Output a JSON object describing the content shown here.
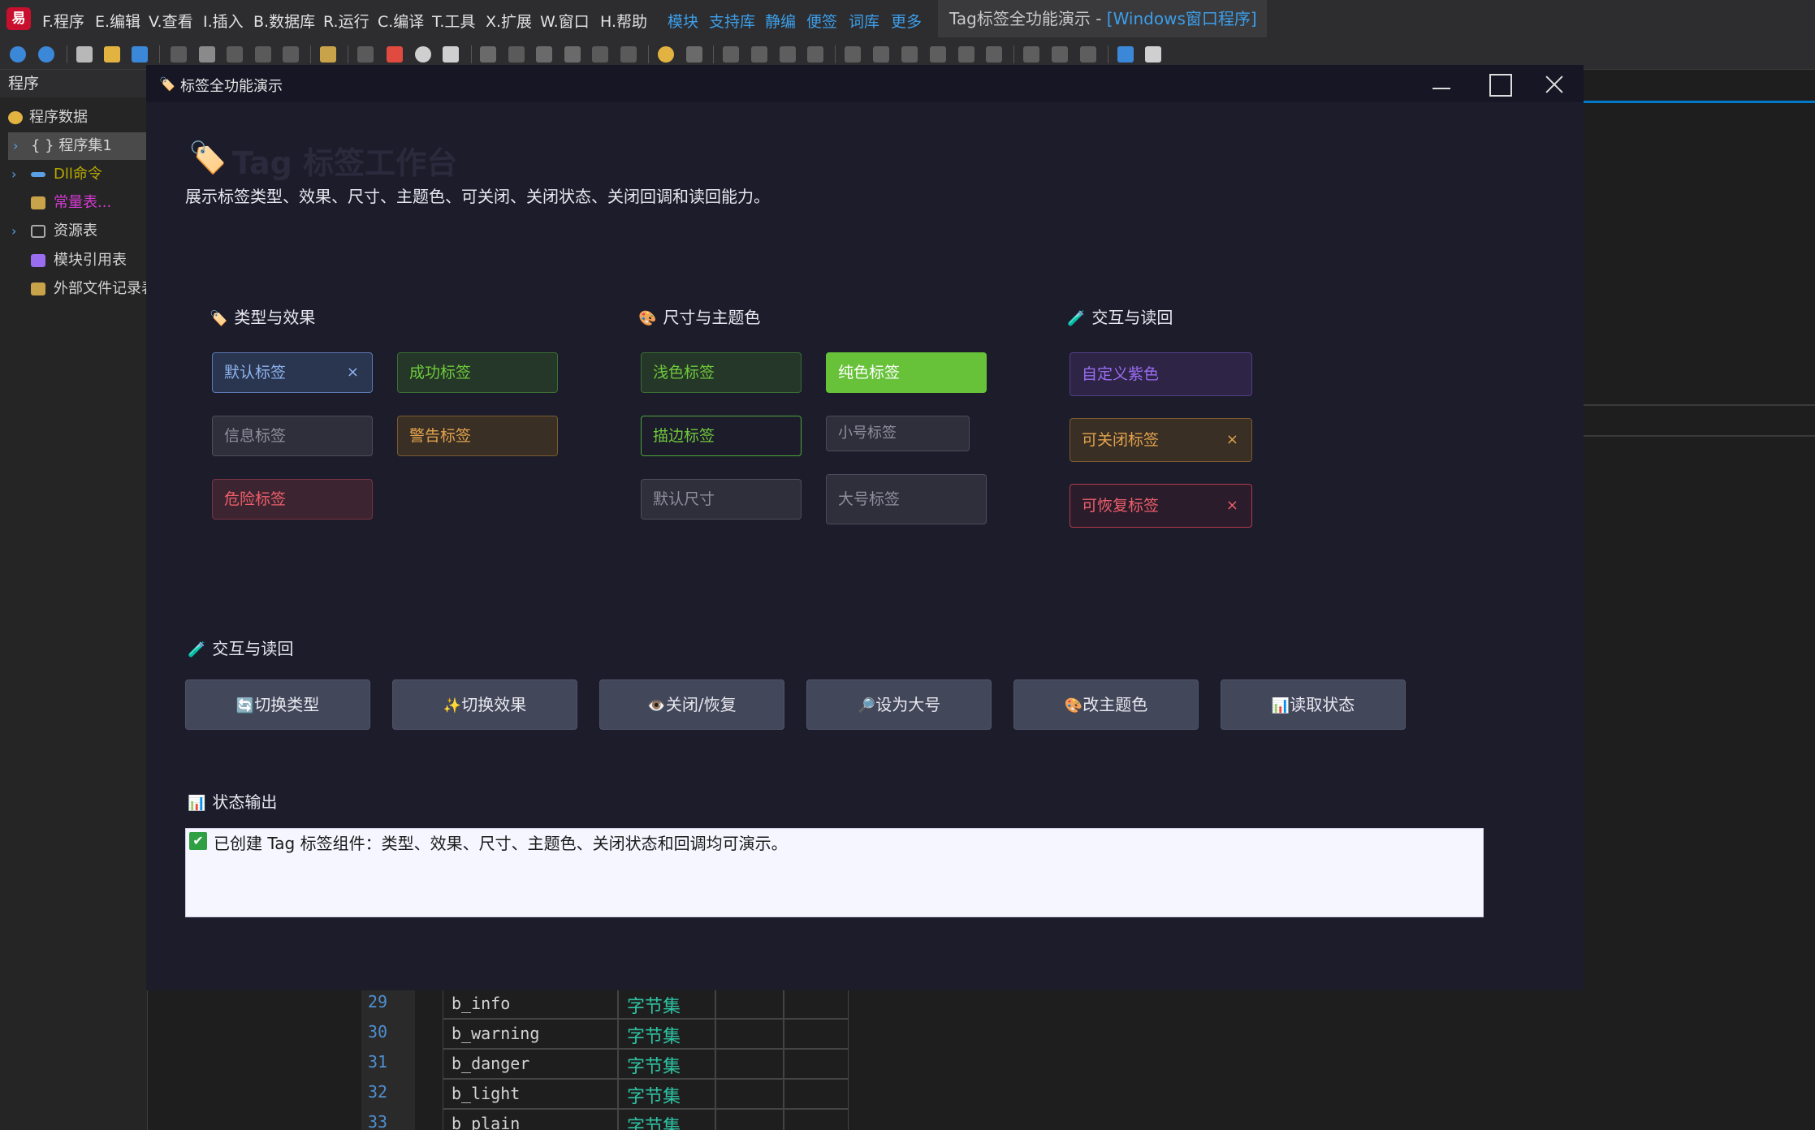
{
  "ide": {
    "logo": "易",
    "menus": [
      "F.程序",
      "E.编辑",
      "V.查看",
      "I.插入",
      "B.数据库",
      "R.运行",
      "C.编译",
      "T.工具",
      "X.扩展",
      "W.窗口",
      "H.帮助"
    ],
    "links": [
      "模块",
      "支持库",
      "静编",
      "便签",
      "词库",
      "更多"
    ],
    "title_main": "Tag标签全功能演示 - ",
    "title_suffix": "[Windows窗口程序]",
    "panel_title": "程序",
    "tree": [
      {
        "label": "程序数据",
        "color": "#d4d4d4",
        "icon": "smile-icon"
      },
      {
        "label": "{ } 程序集1",
        "color": "#d4d4d4",
        "icon": "braces-icon"
      },
      {
        "label": "Dll命令",
        "color": "#b5a800",
        "icon": "plug-icon"
      },
      {
        "label": "常量表...",
        "color": "#d63ad1",
        "icon": "table-icon"
      },
      {
        "label": "资源表",
        "color": "#d4d4d4",
        "icon": "resource-icon"
      },
      {
        "label": "模块引用表",
        "color": "#d4d4d4",
        "icon": "module-icon"
      },
      {
        "label": "外部文件记录表",
        "color": "#d4d4d4",
        "icon": "file-icon"
      }
    ],
    "code_rows": [
      {
        "ln": "29",
        "name": "b_info",
        "type": "字节集"
      },
      {
        "ln": "30",
        "name": "b_warning",
        "type": "字节集"
      },
      {
        "ln": "31",
        "name": "b_danger",
        "type": "字节集"
      },
      {
        "ln": "32",
        "name": "b_light",
        "type": "字节集"
      },
      {
        "ln": "33",
        "name": "b_plain",
        "type": "字节集"
      }
    ]
  },
  "dialog": {
    "title": "标签全功能演示",
    "hero_icon": "🏷️",
    "hero_title": "Tag 标签工作台",
    "subtitle": "展示标签类型、效果、尺寸、主题色、可关闭、关闭状态、关闭回调和读回能力。",
    "sections": {
      "types": {
        "icon": "🏷️",
        "label": "类型与效果"
      },
      "sizes": {
        "icon": "🎨",
        "label": "尺寸与主题色"
      },
      "interact": {
        "icon": "🧪",
        "label": "交互与读回"
      },
      "interact2": {
        "icon": "🧪",
        "label": "交互与读回"
      },
      "output": {
        "icon": "📊",
        "label": "状态输出"
      }
    },
    "tags": {
      "default": "默认标签",
      "success": "成功标签",
      "info": "信息标签",
      "warning": "警告标签",
      "danger": "危险标签",
      "light": "浅色标签",
      "dark": "纯色标签",
      "plain": "描边标签",
      "small": "小号标签",
      "default_size": "默认尺寸",
      "large": "大号标签",
      "purple": "自定义紫色",
      "closable": "可关闭标签",
      "restorable": "可恢复标签"
    },
    "close_glyph": "×",
    "buttons": [
      {
        "icon": "🔄",
        "label": "切换类型"
      },
      {
        "icon": "✨",
        "label": "切换效果"
      },
      {
        "icon": "👁️",
        "label": "关闭/恢复"
      },
      {
        "icon": "🔎",
        "label": "设为大号"
      },
      {
        "icon": "🎨",
        "label": "改主题色"
      },
      {
        "icon": "📊",
        "label": "读取状态"
      }
    ],
    "output_text": "已创建 Tag 标签组件：类型、效果、尺寸、主题色、关闭状态和回调均可演示。",
    "output_check": "✔"
  }
}
